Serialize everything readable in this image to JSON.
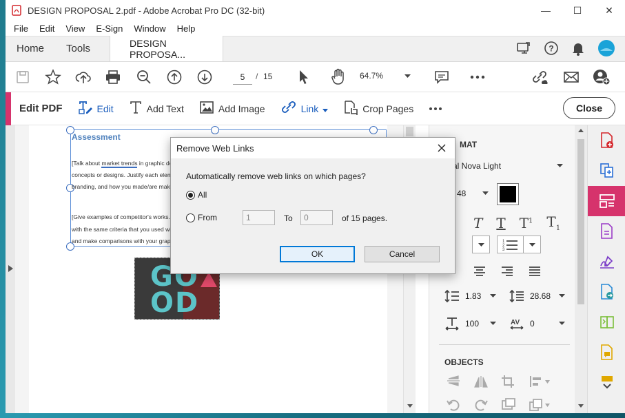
{
  "window": {
    "title": "DESIGN PROPOSAL 2.pdf - Adobe Acrobat Pro DC (32-bit)",
    "minimize": "—",
    "maximize": "☐",
    "close": "✕"
  },
  "menu": [
    "File",
    "Edit",
    "View",
    "E-Sign",
    "Window",
    "Help"
  ],
  "tabs": {
    "home": "Home",
    "tools": "Tools",
    "document": "DESIGN PROPOSA..."
  },
  "toolbar": {
    "current_page": "5",
    "page_sep": "/",
    "total_pages": "15",
    "zoom": "64.7%"
  },
  "editbar": {
    "title": "Edit PDF",
    "edit": "Edit",
    "add_text": "Add Text",
    "add_image": "Add Image",
    "link": "Link",
    "crop_pages": "Crop Pages",
    "close": "Close"
  },
  "document": {
    "heading": "Assessment",
    "line1_pre": "[Talk about ",
    "line1_link": "market trends",
    "line1_post": " in graphic desig",
    "line2": "concepts or designs. Justify each element",
    "line3": "branding, and how you made/are making t",
    "line4": "[Give examples of competitor's works. This",
    "line5": "with the same criteria that you used with th",
    "line6": "and make comparisons with your graphic d",
    "image_text_1": "GO",
    "image_text_2": "OD"
  },
  "right_panel": {
    "format_label": "MAT",
    "font_name": "al Nova Light",
    "font_size": "48",
    "line_spacing": "1.83",
    "para_spacing": "28.68",
    "scale": "100",
    "char_spacing": "0",
    "objects_label": "OBJECTS"
  },
  "dialog": {
    "title": "Remove Web Links",
    "prompt": "Automatically remove web links on which pages?",
    "all_label": "All",
    "from_label": "From",
    "from_value": "1",
    "to_label": "To",
    "to_value": "0",
    "of_label": "of 15 pages.",
    "ok": "OK",
    "cancel": "Cancel"
  },
  "colors": {
    "accent": "#d6336c",
    "link_blue": "#1b5ebd",
    "selection": "#5b8dd6"
  }
}
